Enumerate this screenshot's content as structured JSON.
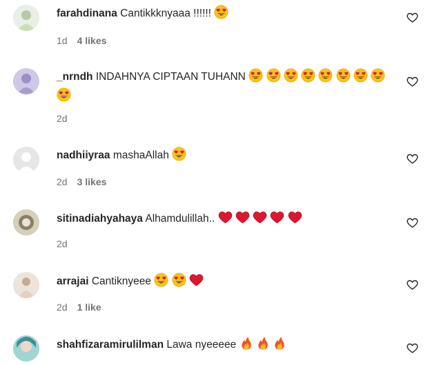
{
  "comments": [
    {
      "username": "farahdinana",
      "text": "Cantikkknyaaa !!!!!!",
      "emoji": [
        "heart-eyes"
      ],
      "time": "1d",
      "likes": "4 likes",
      "avatar_color": "#cfe3c2"
    },
    {
      "username": "_nrndh",
      "text": "INDAHNYA CIPTAAN TUHANN",
      "emoji": [
        "heart-eyes",
        "heart-eyes",
        "heart-eyes",
        "heart-eyes",
        "heart-eyes",
        "heart-eyes",
        "heart-eyes",
        "heart-eyes",
        "heart-eyes"
      ],
      "time": "2d",
      "likes": "",
      "avatar_color": "#b9aedb"
    },
    {
      "username": "nadhiiyraa",
      "text": "mashaAllah",
      "emoji": [
        "heart-eyes"
      ],
      "time": "2d",
      "likes": "3 likes",
      "avatar_color": "#e6e6e6"
    },
    {
      "username": "sitinadiahyahaya",
      "text": "Alhamdulillah..",
      "emoji": [
        "red-heart",
        "red-heart",
        "red-heart",
        "red-heart",
        "red-heart"
      ],
      "time": "2d",
      "likes": "",
      "avatar_color": "#c7c2a8"
    },
    {
      "username": "arrajai",
      "text": "Cantiknyeee",
      "emoji": [
        "heart-eyes",
        "heart-eyes",
        "red-heart"
      ],
      "time": "2d",
      "likes": "1 like",
      "avatar_color": "#d9c9b8"
    },
    {
      "username": "shahfizaramirulilman",
      "text": "Lawa nyeeeee",
      "emoji": [
        "fire",
        "fire",
        "fire"
      ],
      "time": "",
      "likes": "",
      "avatar_color": "#7fc7c9"
    }
  ],
  "colors": {
    "meta": "#737373",
    "text": "#262626",
    "heart_red": "#e0152f",
    "emoji_face": "#fcc21b"
  }
}
